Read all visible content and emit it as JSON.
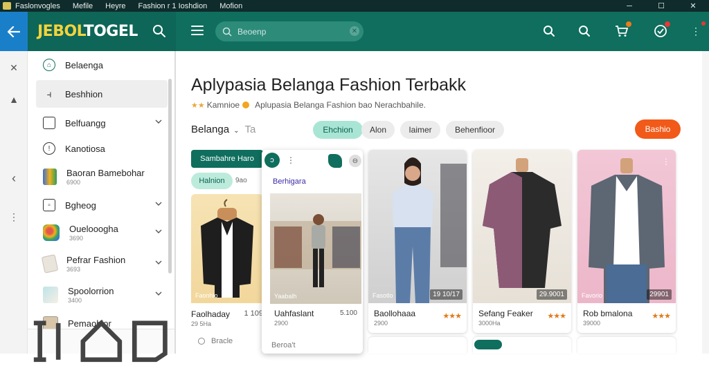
{
  "titlebar": {
    "menu": [
      "Faslonvogles",
      "Mefile",
      "Heyre",
      "Fashion r 1 Ioshdion",
      "Mofion"
    ]
  },
  "header": {
    "brand_part1": "JEBOL",
    "brand_part2": "TOGEL",
    "search_placeholder": "Beoenp",
    "colors": {
      "header_bg": "#0f6e5d",
      "accent": "#f15a19",
      "back_bg": "#1a7fc9"
    }
  },
  "sidebar": {
    "items": [
      {
        "label": "Belaenga",
        "sub": "",
        "icon": "home-icon"
      },
      {
        "label": "Beshhion",
        "sub": "",
        "icon": "grid-icon"
      },
      {
        "label": "Belfuangg",
        "sub": "",
        "icon": "folder-icon"
      },
      {
        "label": "Kanotiosa",
        "sub": "",
        "icon": "location-icon"
      },
      {
        "label": "Baoran Bamebohar",
        "sub": "6900",
        "icon": "color-fan-icon"
      },
      {
        "label": "Bgheog",
        "sub": "",
        "icon": "box-icon"
      },
      {
        "label": "Ouelooogha",
        "sub": "3690",
        "icon": "palette-icon"
      },
      {
        "label": "Pefrar Fashion",
        "sub": "3693",
        "icon": "document-icon"
      },
      {
        "label": "Spoolorrion",
        "sub": "3400",
        "icon": "brush-icon"
      },
      {
        "label": "Pemaohior",
        "sub": "",
        "icon": "photo-icon"
      }
    ]
  },
  "main": {
    "title": "Aplypasia Belanga Fashion Terbakk",
    "subtitle_prefix": "Kamnioe",
    "subtitle_text": "Aplupasia Belanga Fashion bao Nerachbahile.",
    "filter_label": "Belanga",
    "filter_extra": "Ta",
    "chips": [
      "Ehchion",
      "Alon",
      "Iaimer",
      "Behenfioor"
    ],
    "cta": "Bashio",
    "tag_green": "Sambahre Haro",
    "tag_mint": "Halnion",
    "tag_mint_sub": "9ao",
    "popover": {
      "circle": "ↄ",
      "label": "Berhigara",
      "bottom": "Beroa't"
    },
    "search2": "Bracle"
  },
  "cards": [
    {
      "name": "Faolhaday",
      "meta": "29 5Ha",
      "price": "1 109",
      "img_tag": "Faonhio",
      "stars": ""
    },
    {
      "name": "Uahfaslant",
      "meta": "2900",
      "price": "5.100",
      "img_tag": "Yaabalh",
      "stars": ""
    },
    {
      "name": "Baollohaaa",
      "meta": "2900",
      "price": "19 10/17",
      "img_tag": "Fasotlo",
      "stars": "★★★"
    },
    {
      "name": "Sefang Feaker",
      "meta": "3000Ha",
      "price": "29.9001",
      "img_tag": "",
      "stars": "★★★"
    },
    {
      "name": "Rob bmalona",
      "meta": "39000",
      "price": "29901",
      "img_tag": "Favorio",
      "stars": "★★★"
    }
  ]
}
